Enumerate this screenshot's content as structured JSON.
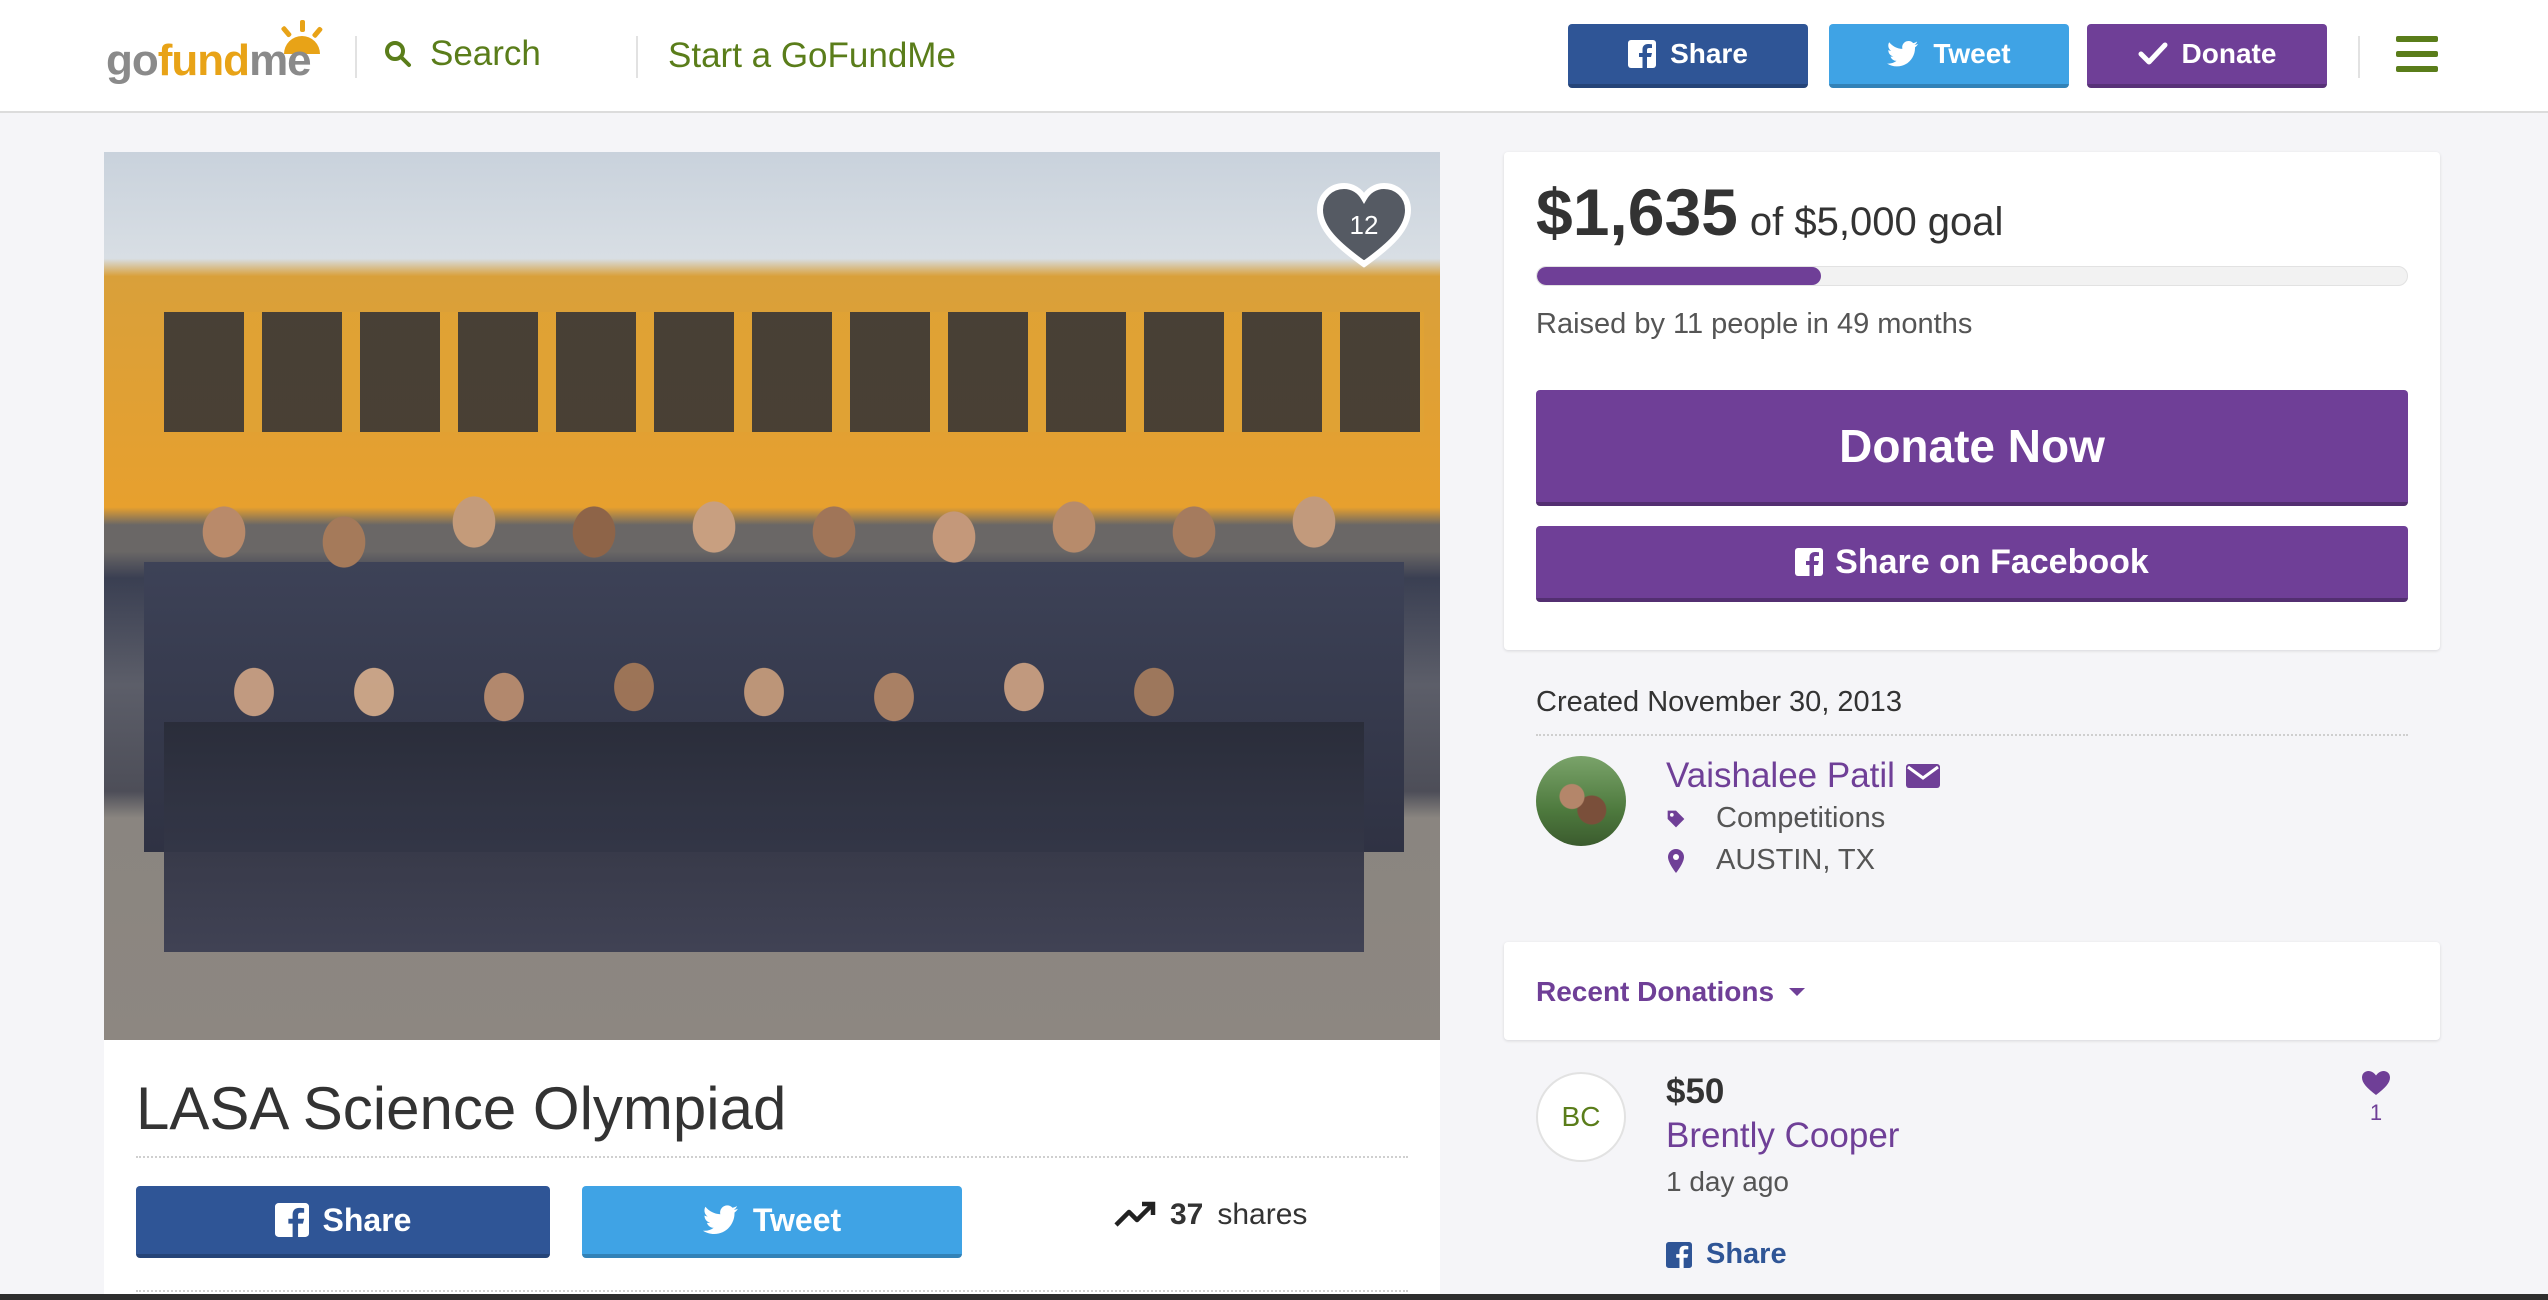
{
  "header": {
    "logo": {
      "go": "go",
      "fund": "fund",
      "me": "me"
    },
    "search_label": "Search",
    "start_label": "Start a GoFundMe",
    "share_label": "Share",
    "tweet_label": "Tweet",
    "donate_label": "Donate"
  },
  "campaign": {
    "likes": "12",
    "title": "LASA Science Olympiad",
    "share_label": "Share",
    "tweet_label": "Tweet",
    "shares_count": "37",
    "shares_label": "shares"
  },
  "goal": {
    "raised": "$1,635",
    "goal_text": "of $5,000 goal",
    "progress": 0.327,
    "raised_by": "Raised by 11 people in 49 months",
    "donate_now": "Donate Now",
    "share_facebook": "Share on Facebook"
  },
  "organizer": {
    "created": "Created November 30, 2013",
    "name": "Vaishalee Patil",
    "category": "Competitions",
    "location": "AUSTIN, TX"
  },
  "recent": {
    "title": "Recent Donations",
    "donations": [
      {
        "initials": "BC",
        "amount": "$50",
        "name": "Brently Cooper",
        "time": "1 day ago",
        "likes": "1",
        "share_label": "Share"
      }
    ]
  },
  "colors": {
    "brand_green": "#5a7d1a",
    "facebook": "#2f5596",
    "twitter": "#3fa3e5",
    "purple": "#6f3f97",
    "logo_orange": "#e8a317"
  },
  "icons": [
    "search-icon",
    "facebook-icon",
    "twitter-icon",
    "check-icon",
    "menu-icon",
    "heart-icon",
    "trending-icon",
    "envelope-icon",
    "tag-icon",
    "location-icon",
    "caret-down-icon"
  ]
}
